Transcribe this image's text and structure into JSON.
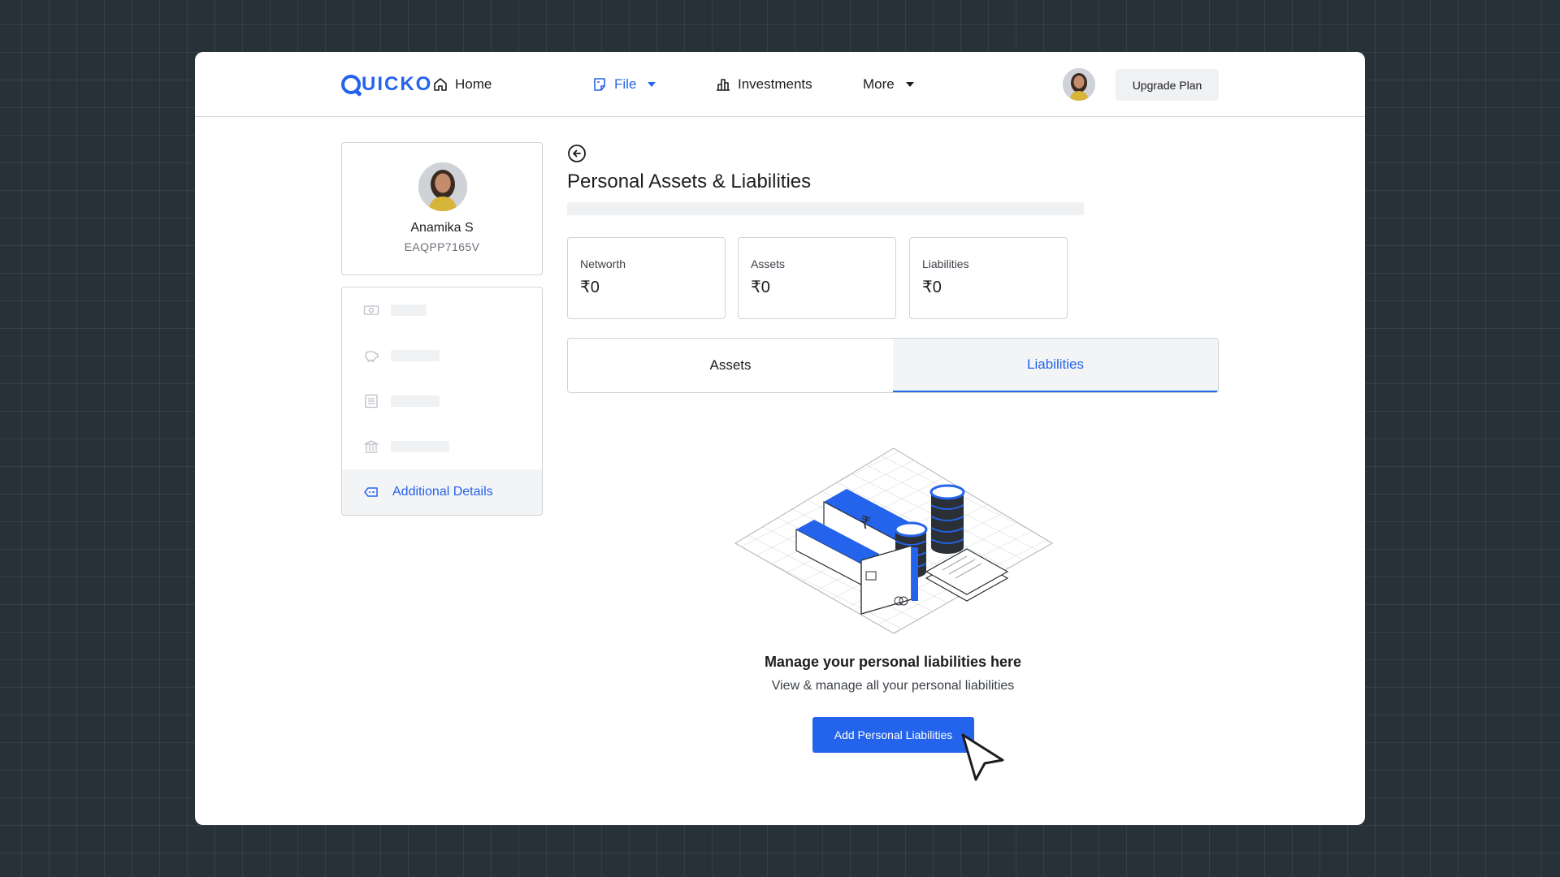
{
  "header": {
    "logo": "QUICKO",
    "nav": [
      {
        "label": "Home",
        "icon": "home-icon"
      },
      {
        "label": "File",
        "icon": "file-icon"
      },
      {
        "label": "Investments",
        "icon": "investments-icon"
      },
      {
        "label": "More"
      }
    ],
    "upgrade_label": "Upgrade Plan"
  },
  "profile": {
    "name": "Anamika S",
    "pan": "EAQPP7165V"
  },
  "sidebar": {
    "items": [
      {
        "icon": "cash-icon"
      },
      {
        "icon": "piggy-bank-icon"
      },
      {
        "icon": "document-list-icon"
      },
      {
        "icon": "bank-icon"
      },
      {
        "icon": "tag-icon",
        "label": "Additional Details"
      }
    ]
  },
  "main": {
    "title": "Personal Assets & Liabilities",
    "stats": [
      {
        "label": "Networth",
        "value": "₹0"
      },
      {
        "label": "Assets",
        "value": "₹0"
      },
      {
        "label": "Liabilities",
        "value": "₹0"
      }
    ],
    "tabs": [
      {
        "label": "Assets"
      },
      {
        "label": "Liabilities"
      }
    ],
    "active_tab": "Liabilities",
    "empty_state": {
      "title": "Manage your personal liabilities here",
      "subtitle": "View & manage all your personal liabilities",
      "button_label": "Add Personal Liabilities"
    }
  },
  "colors": {
    "accent": "#2463eb",
    "background": "#263238",
    "border": "#cfd3d8"
  }
}
